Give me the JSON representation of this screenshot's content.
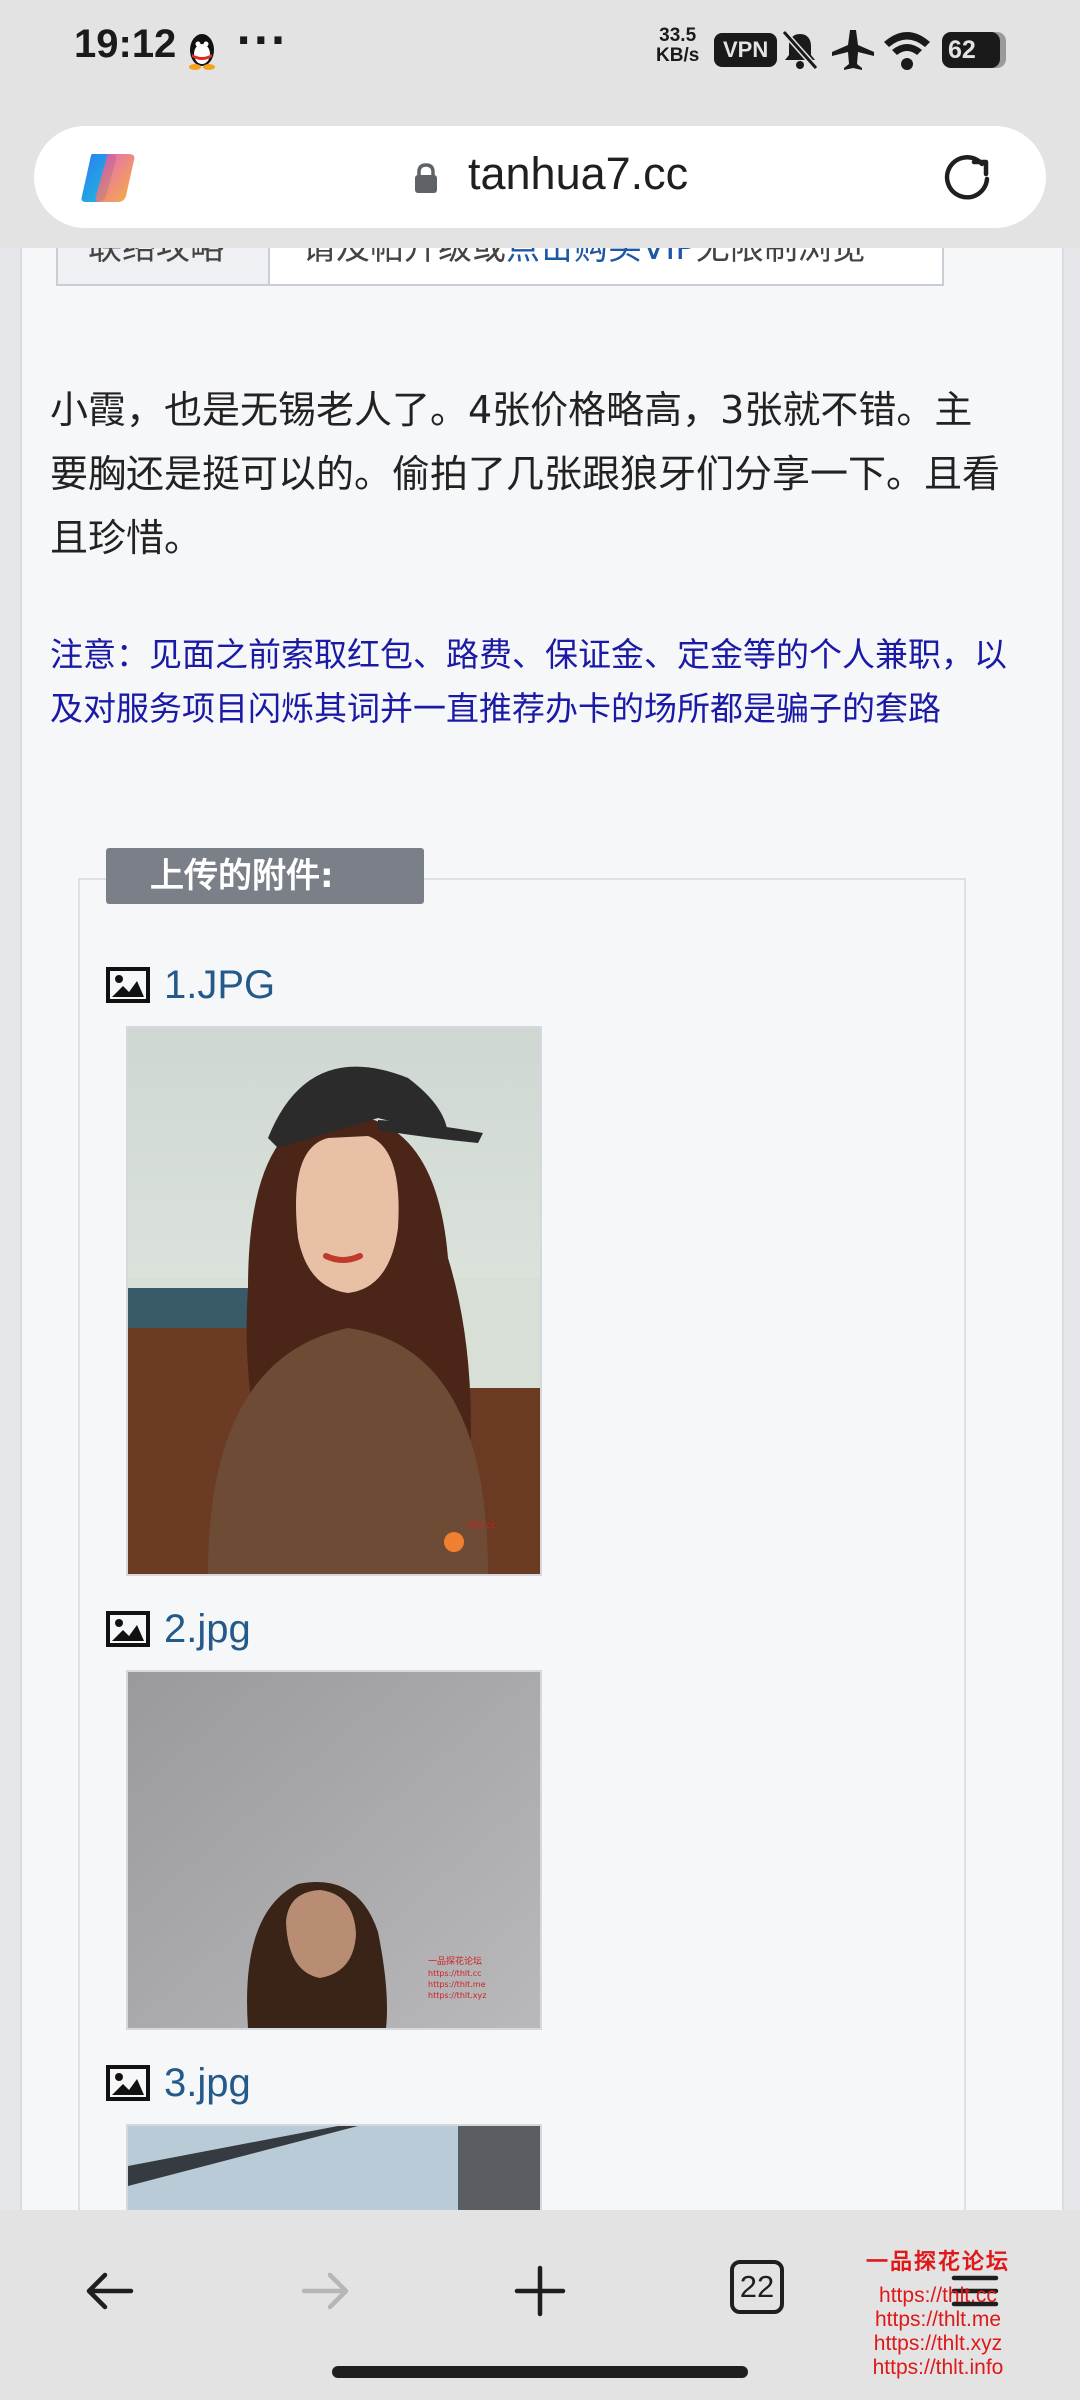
{
  "status_bar": {
    "time": "19:12",
    "more": "···",
    "net_speed_value": "33.5",
    "net_speed_unit": "KB/s",
    "vpn": "VPN",
    "battery": "62"
  },
  "browser": {
    "url": "tanhua7.cc",
    "tab_count": "22"
  },
  "page": {
    "top_table_left": "联络攻略",
    "top_table_right_prefix": "请及帖升级或",
    "top_table_right_link": "点击购买VIP",
    "top_table_right_suffix": "无限制浏览",
    "post_text": "小霞，也是无锡老人了。4张价格略高，3张就不错。主要胸还是挺可以的。偷拍了几张跟狼牙们分享一下。且看且珍惜。",
    "notice_text": "注意：见面之前索取红包、路费、保证金、定金等的个人兼职，以及对服务项目闪烁其词并一直推荐办卡的场所都是骗子的套路",
    "attachments_legend": "上传的附件:",
    "attachments": [
      {
        "name": "1.JPG"
      },
      {
        "name": "2.jpg"
      },
      {
        "name": "3.jpg"
      }
    ]
  },
  "watermark": {
    "title": "一品探花论坛",
    "lines": [
      "https://thlt.cc",
      "https://thlt.me",
      "https://thlt.xyz",
      "https://thlt.info"
    ]
  },
  "colors": {
    "notice": "#1a1aa6",
    "link": "#235a8a",
    "watermark": "#e01818",
    "legend_bg": "#7b8088"
  }
}
